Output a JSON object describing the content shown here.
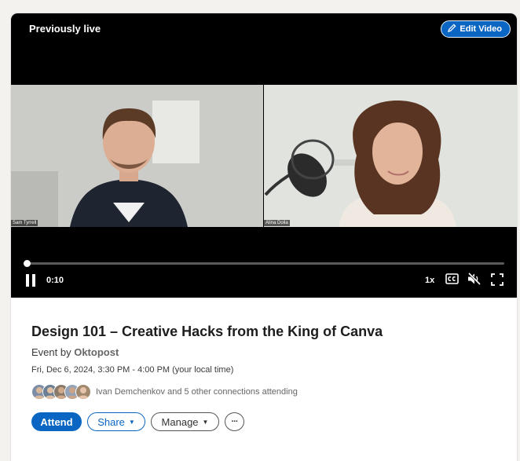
{
  "player": {
    "status_label": "Previously live",
    "edit_label": "Edit Video",
    "current_time": "0:10",
    "speed": "1x",
    "progress_fraction": 0.0
  },
  "participants": [
    {
      "name": "Sam Tyrrell"
    },
    {
      "name": "Alina Doila"
    }
  ],
  "event": {
    "title": "Design 101 – Creative Hacks from the King of Canva",
    "organizer_prefix": "Event by",
    "organizer_name": "Oktopost",
    "datetime": "Fri, Dec 6, 2024, 3:30 PM - 4:00 PM (your local time)",
    "attendees_text": "Ivan Demchenkov and 5 other connections attending",
    "avatar_count": 5
  },
  "actions": {
    "attend": "Attend",
    "share": "Share",
    "manage": "Manage",
    "more": "···"
  },
  "colors": {
    "accent": "#0a66c2",
    "player_bg": "#000000"
  }
}
